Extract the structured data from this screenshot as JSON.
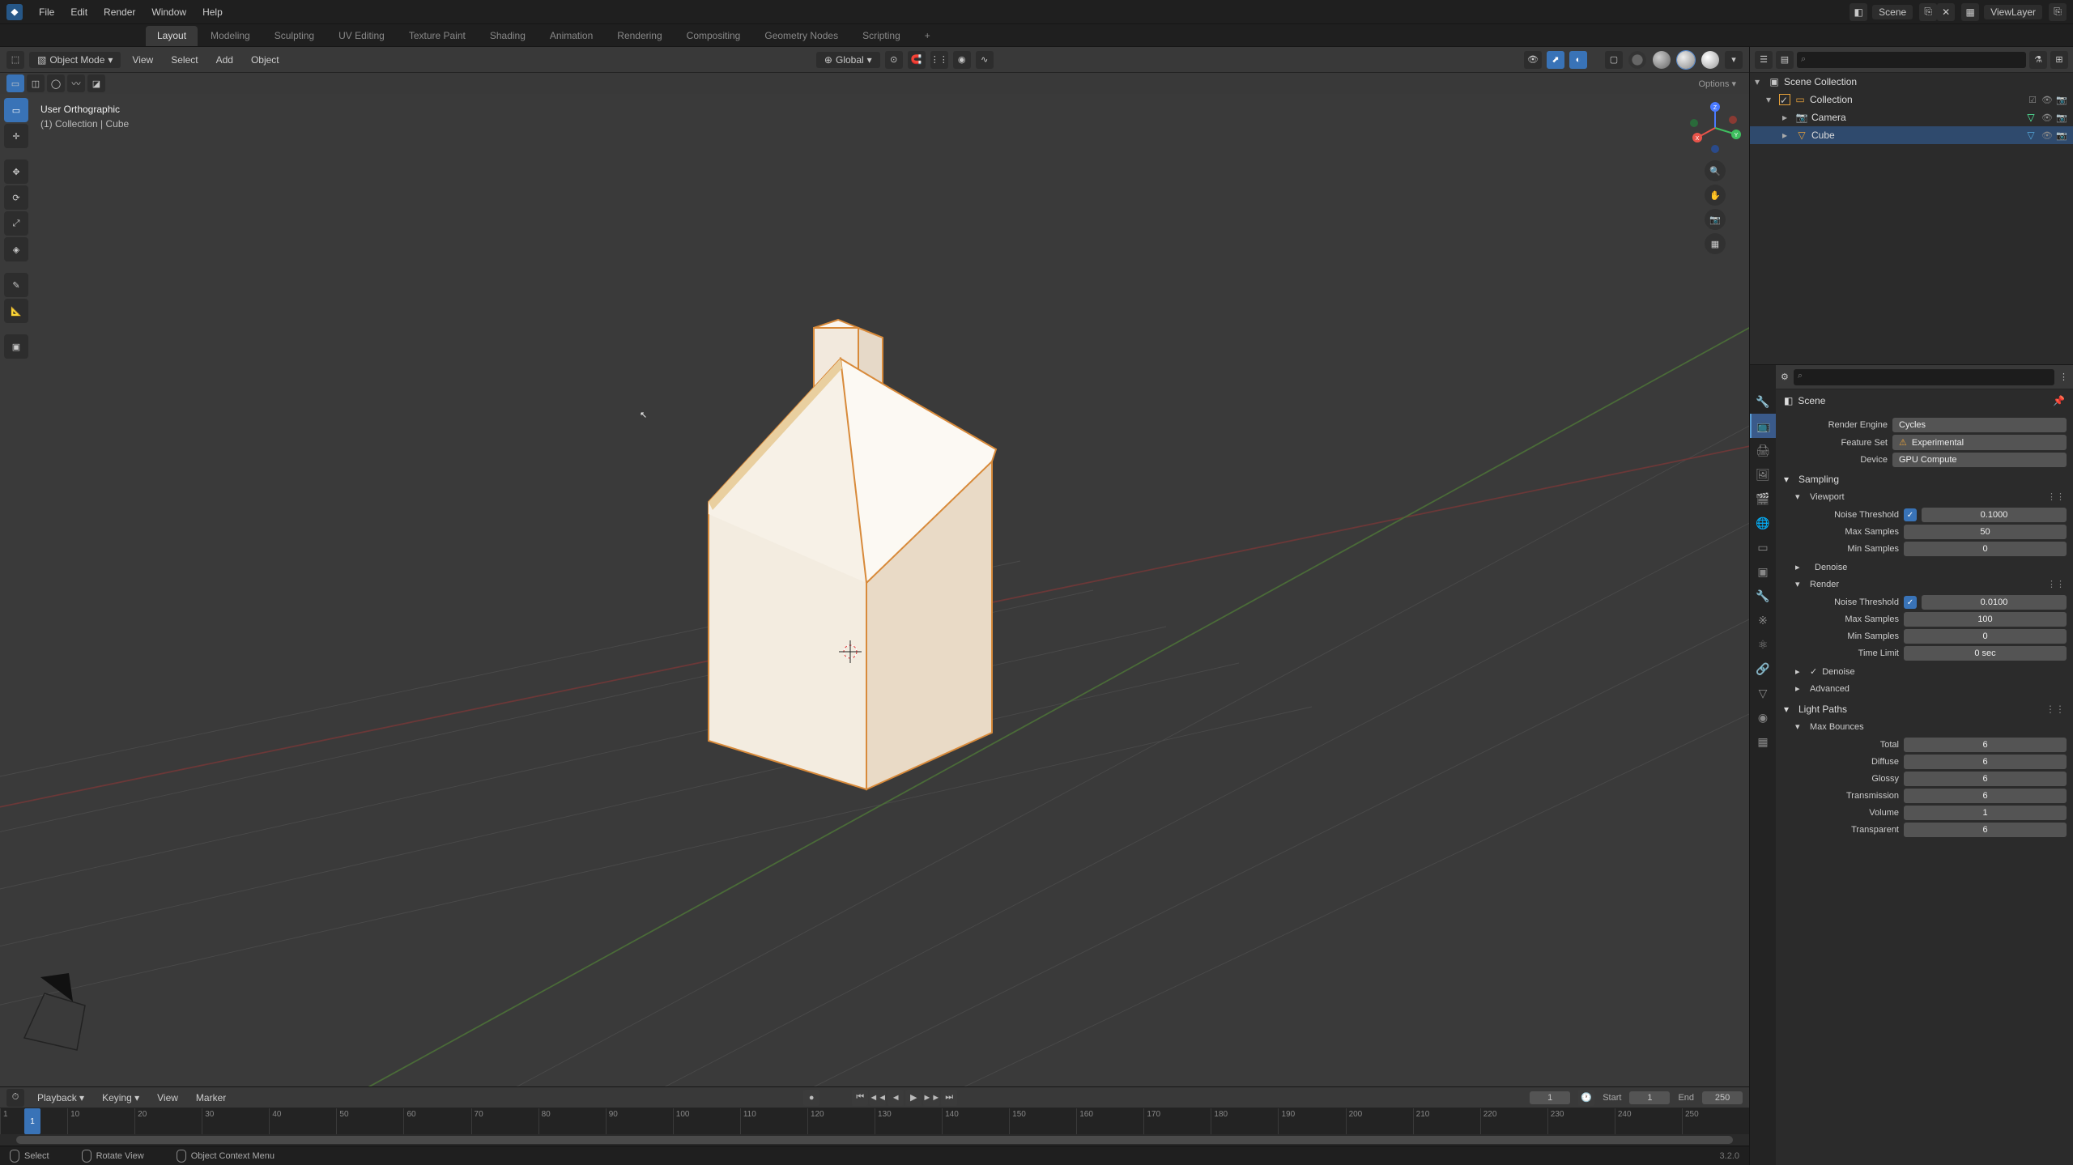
{
  "topbar": {
    "menus": [
      "File",
      "Edit",
      "Render",
      "Window",
      "Help"
    ],
    "scene_label": "Scene",
    "viewlayer_label": "ViewLayer"
  },
  "workspaces": {
    "tabs": [
      "Layout",
      "Modeling",
      "Sculpting",
      "UV Editing",
      "Texture Paint",
      "Shading",
      "Animation",
      "Rendering",
      "Compositing",
      "Geometry Nodes",
      "Scripting"
    ],
    "active": "Layout",
    "add": "+"
  },
  "viewport_header": {
    "mode": "Object Mode",
    "menus": [
      "View",
      "Select",
      "Add",
      "Object"
    ],
    "orientation": "Global",
    "options_label": "Options"
  },
  "viewport_info": {
    "line1": "User Orthographic",
    "line2": "(1) Collection | Cube"
  },
  "timeline": {
    "menus": [
      "Playback",
      "Keying",
      "View",
      "Marker"
    ],
    "current_frame": "1",
    "start_label": "Start",
    "start_value": "1",
    "end_label": "End",
    "end_value": "250",
    "ticks": [
      "1",
      "10",
      "20",
      "30",
      "40",
      "50",
      "60",
      "70",
      "80",
      "90",
      "100",
      "110",
      "120",
      "130",
      "140",
      "150",
      "160",
      "170",
      "180",
      "190",
      "200",
      "210",
      "220",
      "230",
      "240",
      "250"
    ]
  },
  "statusbar": {
    "select": "Select",
    "rotate": "Rotate View",
    "context": "Object Context Menu",
    "version": "3.2.0"
  },
  "outliner": {
    "scene_collection": "Scene Collection",
    "collection": "Collection",
    "items": [
      {
        "name": "Camera",
        "icon": "camera-icon"
      },
      {
        "name": "Cube",
        "icon": "mesh-icon",
        "selected": true
      }
    ]
  },
  "properties": {
    "breadcrumb": "Scene",
    "render_engine_label": "Render Engine",
    "render_engine_value": "Cycles",
    "feature_set_label": "Feature Set",
    "feature_set_value": "Experimental",
    "device_label": "Device",
    "device_value": "GPU Compute",
    "sections": {
      "sampling": "Sampling",
      "viewport": "Viewport",
      "render": "Render",
      "denoise": "Denoise",
      "advanced": "Advanced",
      "light_paths": "Light Paths",
      "max_bounces": "Max Bounces"
    },
    "viewport_sampling": {
      "noise_threshold_label": "Noise Threshold",
      "noise_threshold_value": "0.1000",
      "max_samples_label": "Max Samples",
      "max_samples_value": "50",
      "min_samples_label": "Min Samples",
      "min_samples_value": "0"
    },
    "render_sampling": {
      "noise_threshold_label": "Noise Threshold",
      "noise_threshold_value": "0.0100",
      "max_samples_label": "Max Samples",
      "max_samples_value": "100",
      "min_samples_label": "Min Samples",
      "min_samples_value": "0",
      "time_limit_label": "Time Limit",
      "time_limit_value": "0 sec"
    },
    "max_bounces": {
      "total_label": "Total",
      "total_value": "6",
      "diffuse_label": "Diffuse",
      "diffuse_value": "6",
      "glossy_label": "Glossy",
      "glossy_value": "6",
      "transmission_label": "Transmission",
      "transmission_value": "6",
      "volume_label": "Volume",
      "volume_value": "1",
      "transparent_label": "Transparent",
      "transparent_value": "6"
    }
  }
}
